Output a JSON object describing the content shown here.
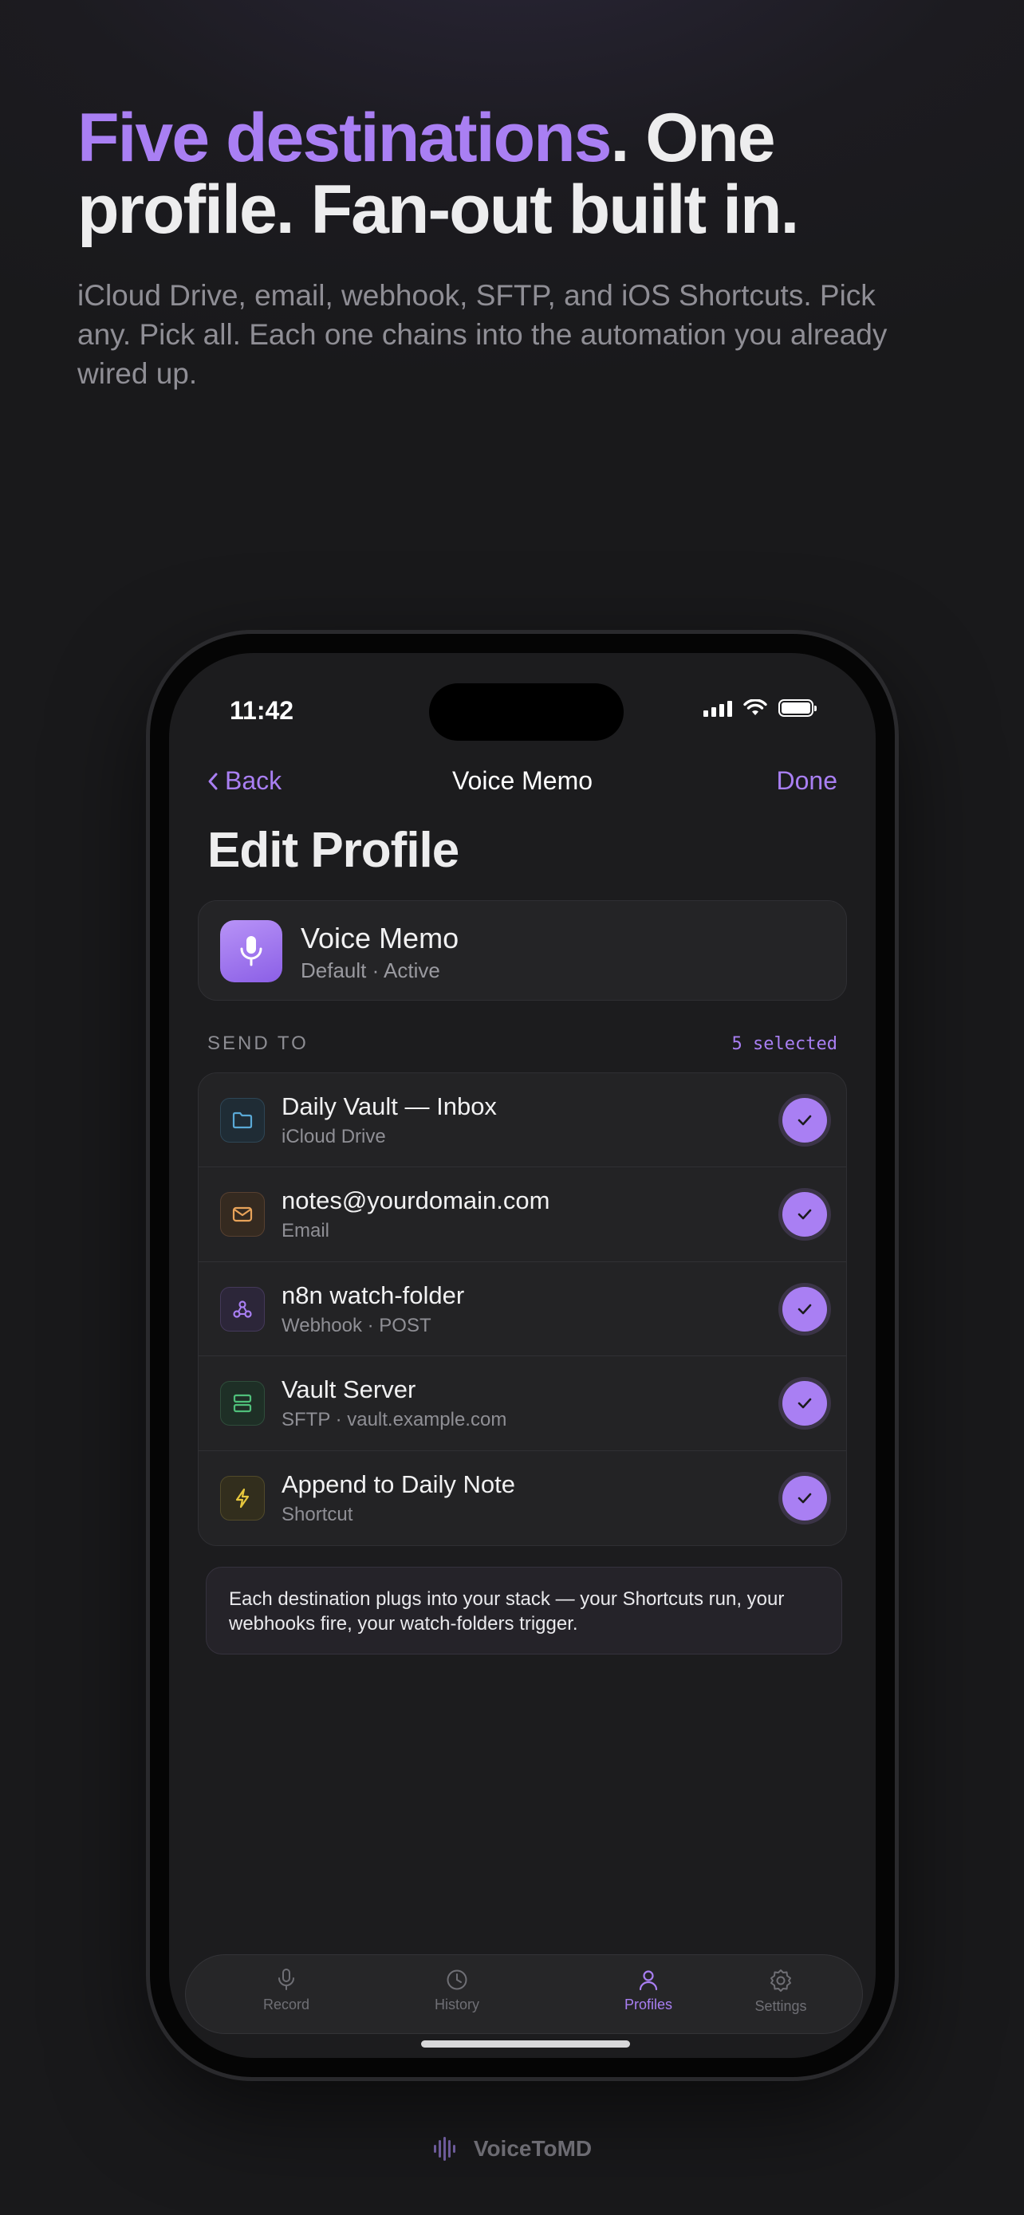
{
  "hero": {
    "headline_accent": "Five destinations",
    "headline_rest": ". One profile. Fan-out built in.",
    "subtitle": "iCloud Drive, email, webhook, SFTP, and iOS Shortcuts. Pick any. Pick all. Each one chains into the automation you already wired up."
  },
  "status_bar": {
    "time": "11:42"
  },
  "nav": {
    "back_label": "Back",
    "title": "Voice Memo",
    "done_label": "Done"
  },
  "page_title": "Edit Profile",
  "profile": {
    "name": "Voice Memo",
    "subtitle": "Default · Active",
    "icon": "microphone-icon"
  },
  "send_to": {
    "label": "SEND TO",
    "count": "5 selected",
    "destinations": [
      {
        "title": "Daily Vault — Inbox",
        "subtitle": "iCloud Drive",
        "icon": "folder-icon",
        "color": "#5aa9d6",
        "selected": true
      },
      {
        "title": "notes@yourdomain.com",
        "subtitle": "Email",
        "icon": "mail-icon",
        "color": "#e8a35a",
        "selected": true
      },
      {
        "title": "n8n watch-folder",
        "subtitle": "Webhook · POST",
        "icon": "webhook-icon",
        "color": "#a97ff3",
        "selected": true
      },
      {
        "title": "Vault Server",
        "subtitle": "SFTP · vault.example.com",
        "icon": "server-icon",
        "color": "#4fbf7a",
        "selected": true
      },
      {
        "title": "Append to Daily Note",
        "subtitle": "Shortcut",
        "icon": "bolt-icon",
        "color": "#e6c73d",
        "selected": true
      }
    ]
  },
  "info_text": "Each destination plugs into your stack — your Shortcuts run, your webhooks fire, your watch-folders trigger.",
  "tabs": [
    {
      "label": "Record",
      "icon": "mic-icon",
      "active": false
    },
    {
      "label": "History",
      "icon": "clock-icon",
      "active": false
    },
    {
      "label": "Profiles",
      "icon": "person-icon",
      "active": true
    },
    {
      "label": "Settings",
      "icon": "gear-icon",
      "active": false
    }
  ],
  "brand": {
    "name": "VoiceToMD",
    "icon": "waveform-icon"
  },
  "colors": {
    "accent": "#a97ff3",
    "background": "#1c1c1e",
    "card": "#232325"
  }
}
